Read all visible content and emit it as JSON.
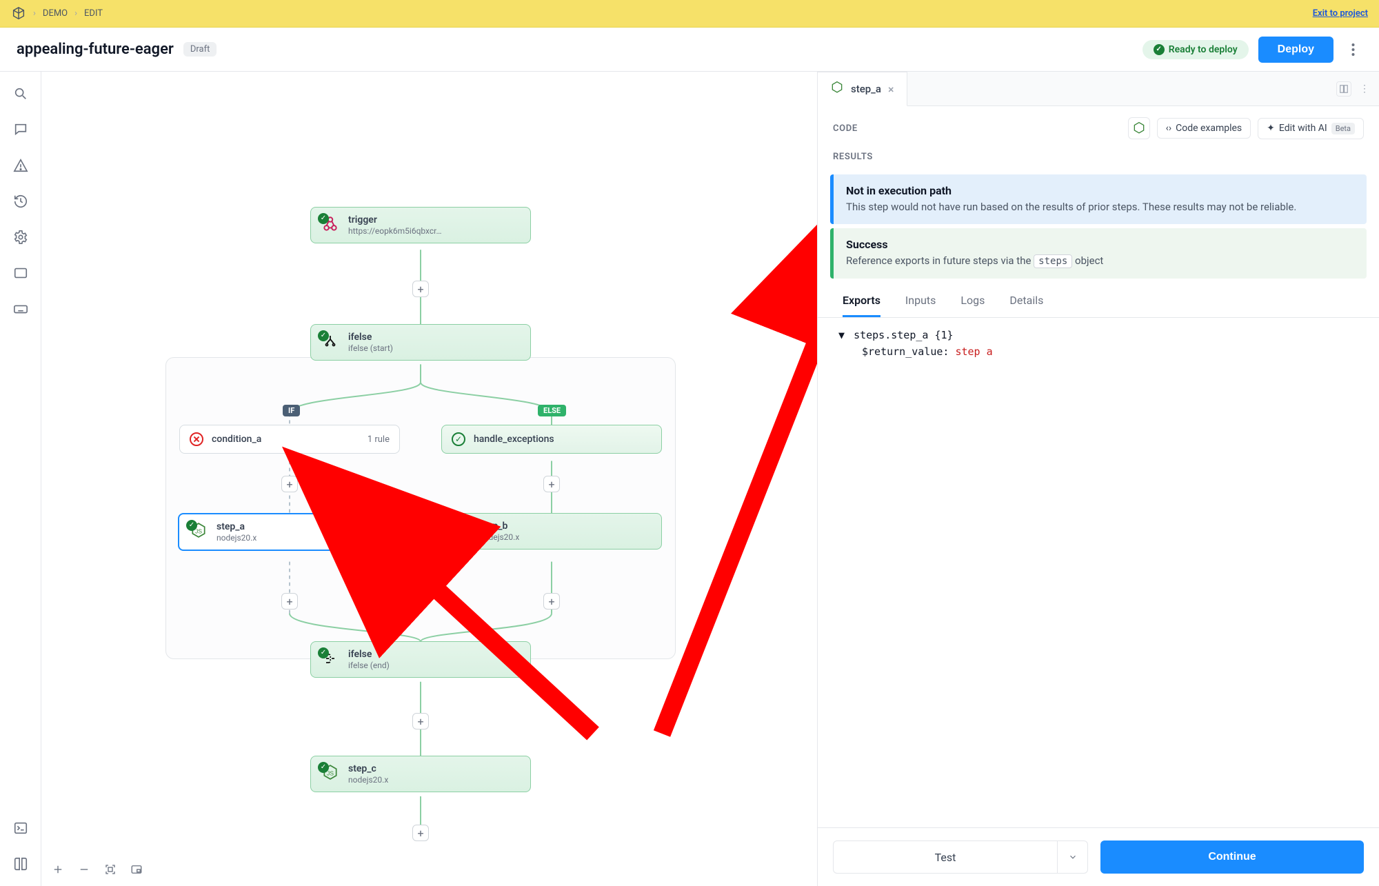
{
  "topbar": {
    "crumbs": [
      "DEMO",
      "EDIT"
    ],
    "exit_label": "Exit to project"
  },
  "header": {
    "title": "appealing-future-eager",
    "status_pill": "Draft",
    "ready_label": "Ready to deploy",
    "deploy_label": "Deploy"
  },
  "workflow": {
    "trigger": {
      "title": "trigger",
      "subtitle": "https://eopk6m5i6qbxcr…"
    },
    "ifelse_start": {
      "title": "ifelse",
      "subtitle": "ifelse (start)"
    },
    "branch_if_label": "IF",
    "branch_else_label": "ELSE",
    "condition_a": {
      "title": "condition_a",
      "rule_count": "1 rule"
    },
    "handle_exceptions": {
      "title": "handle_exceptions"
    },
    "step_a": {
      "title": "step_a",
      "subtitle": "nodejs20.x"
    },
    "step_b": {
      "title": "step_b",
      "subtitle": "nodejs20.x"
    },
    "ifelse_end": {
      "title": "ifelse",
      "subtitle": "ifelse (end)"
    },
    "step_c": {
      "title": "step_c",
      "subtitle": "nodejs20.x"
    }
  },
  "panel": {
    "tab_title": "step_a",
    "section_code": "CODE",
    "section_results": "RESULTS",
    "code_examples_label": "Code examples",
    "edit_ai_label": "Edit with AI",
    "beta_label": "Beta",
    "banner_notpath": {
      "title": "Not in execution path",
      "body": "This step would not have run based on the results of prior steps. These results may not be reliable."
    },
    "banner_success": {
      "title": "Success",
      "body_pre": "Reference exports in future steps via the ",
      "body_code": "steps",
      "body_post": " object"
    },
    "subtabs": {
      "exports": "Exports",
      "inputs": "Inputs",
      "logs": "Logs",
      "details": "Details"
    },
    "exports": {
      "root": "steps.step_a {1}",
      "kv_key": "$return_value:",
      "kv_value": "step a"
    },
    "footer": {
      "test": "Test",
      "continue": "Continue"
    }
  }
}
